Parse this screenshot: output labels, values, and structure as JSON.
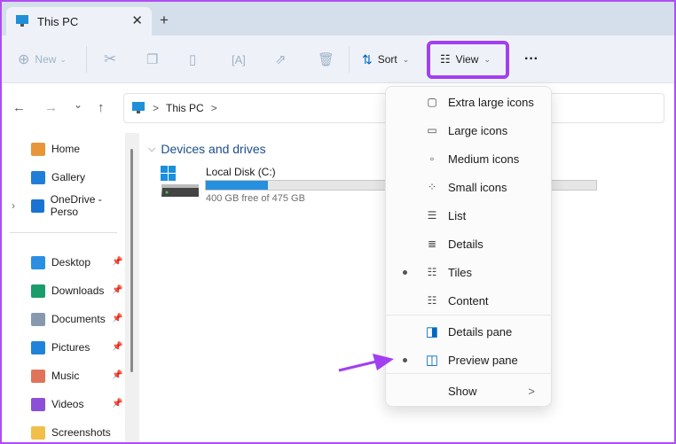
{
  "tab": {
    "title": "This PC",
    "close": "✕",
    "new_tab": "+"
  },
  "toolbar": {
    "new_label": "New",
    "sort_label": "Sort",
    "view_label": "View",
    "more": "···"
  },
  "nav": {
    "back": "←",
    "forward": "→",
    "recent": "⌄",
    "up": "↑"
  },
  "breadcrumb": {
    "items": [
      "This PC"
    ],
    "sep": ">"
  },
  "sidebar": {
    "items": [
      {
        "label": "Home",
        "color": "#e8963a"
      },
      {
        "label": "Gallery",
        "color": "#1f7fd6"
      },
      {
        "label": "OneDrive - Perso",
        "color": "#1a73d0"
      },
      {
        "label": "Desktop",
        "color": "#2a8fe0",
        "pinned": true
      },
      {
        "label": "Downloads",
        "color": "#1a9c6b",
        "pinned": true
      },
      {
        "label": "Documents",
        "color": "#8799ad",
        "pinned": true
      },
      {
        "label": "Pictures",
        "color": "#2083da",
        "pinned": true
      },
      {
        "label": "Music",
        "color": "#e0745a",
        "pinned": true
      },
      {
        "label": "Videos",
        "color": "#8b4fd8",
        "pinned": true
      },
      {
        "label": "Screenshots",
        "color": "#f1bf4a"
      }
    ]
  },
  "main": {
    "section": "Devices and drives",
    "drive": {
      "name": "Local Disk (C:)",
      "info": "400 GB free of 475 GB",
      "used_fraction": 0.158
    }
  },
  "view_menu": {
    "items": [
      {
        "label": "Extra large icons",
        "icon": "extra-large-icons-icon",
        "selected": false
      },
      {
        "label": "Large icons",
        "icon": "large-icons-icon",
        "selected": false
      },
      {
        "label": "Medium icons",
        "icon": "medium-icons-icon",
        "selected": false
      },
      {
        "label": "Small icons",
        "icon": "small-icons-icon",
        "selected": false
      },
      {
        "label": "List",
        "icon": "list-icon",
        "selected": false
      },
      {
        "label": "Details",
        "icon": "details-icon",
        "selected": false
      },
      {
        "label": "Tiles",
        "icon": "tiles-icon",
        "selected": true
      },
      {
        "label": "Content",
        "icon": "content-icon",
        "selected": false
      },
      {
        "label": "Details pane",
        "icon": "details-pane-icon",
        "selected": false
      },
      {
        "label": "Preview pane",
        "icon": "preview-pane-icon",
        "selected": true
      },
      {
        "label": "Show",
        "icon": "",
        "selected": false
      }
    ],
    "show_chevron": ">"
  },
  "colors": {
    "highlight": "#a23ff0",
    "accent": "#0067c0"
  }
}
